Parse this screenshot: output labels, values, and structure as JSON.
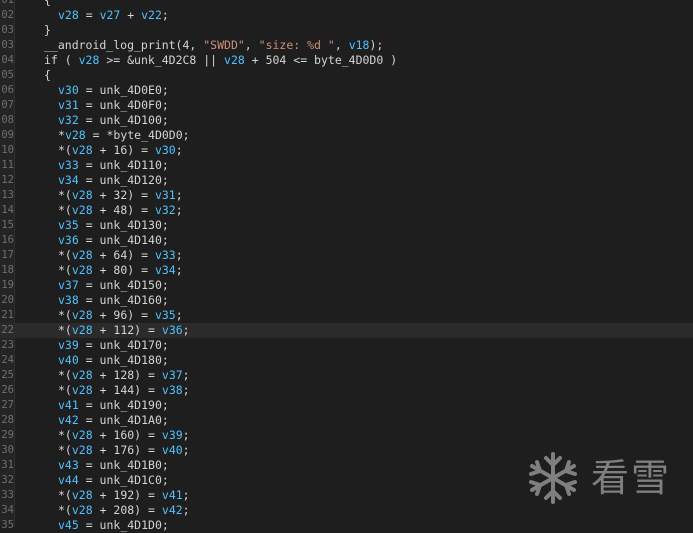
{
  "editor": {
    "lines": [
      {
        "ln": "01",
        "tokens": [
          {
            "t": "{",
            "c": "plain"
          }
        ],
        "indent": 1
      },
      {
        "ln": "02",
        "tokens": [
          {
            "t": "v28",
            "c": "var"
          },
          {
            "t": " = ",
            "c": "plain"
          },
          {
            "t": "v27",
            "c": "var"
          },
          {
            "t": " + ",
            "c": "plain"
          },
          {
            "t": "v22",
            "c": "var"
          },
          {
            "t": ";",
            "c": "plain"
          }
        ],
        "indent": 2
      },
      {
        "ln": "03",
        "tokens": [
          {
            "t": "}",
            "c": "plain"
          }
        ],
        "indent": 1
      },
      {
        "ln": "03",
        "tokens": [
          {
            "t": "__android_log_print(4, ",
            "c": "plain"
          },
          {
            "t": "\"SWDD\"",
            "c": "str"
          },
          {
            "t": ", ",
            "c": "plain"
          },
          {
            "t": "\"size: %d \"",
            "c": "str"
          },
          {
            "t": ", ",
            "c": "plain"
          },
          {
            "t": "v18",
            "c": "var"
          },
          {
            "t": ");",
            "c": "plain"
          }
        ],
        "indent": 1
      },
      {
        "ln": "04",
        "tokens": [
          {
            "t": "if ( ",
            "c": "plain"
          },
          {
            "t": "v28",
            "c": "var"
          },
          {
            "t": " >= &unk_4D2C8 || ",
            "c": "plain"
          },
          {
            "t": "v28",
            "c": "var"
          },
          {
            "t": " + 504 <= byte_4D0D0 )",
            "c": "plain"
          }
        ],
        "indent": 1
      },
      {
        "ln": "05",
        "tokens": [
          {
            "t": "{",
            "c": "plain"
          }
        ],
        "indent": 1
      },
      {
        "ln": "06",
        "tokens": [
          {
            "t": "v30",
            "c": "var"
          },
          {
            "t": " = unk_4D0E0;",
            "c": "plain"
          }
        ],
        "indent": 2
      },
      {
        "ln": "07",
        "tokens": [
          {
            "t": "v31",
            "c": "var"
          },
          {
            "t": " = unk_4D0F0;",
            "c": "plain"
          }
        ],
        "indent": 2
      },
      {
        "ln": "08",
        "tokens": [
          {
            "t": "v32",
            "c": "var"
          },
          {
            "t": " = unk_4D100;",
            "c": "plain"
          }
        ],
        "indent": 2
      },
      {
        "ln": "09",
        "tokens": [
          {
            "t": "*",
            "c": "plain"
          },
          {
            "t": "v28",
            "c": "var"
          },
          {
            "t": " = *byte_4D0D0;",
            "c": "plain"
          }
        ],
        "indent": 2
      },
      {
        "ln": "10",
        "tokens": [
          {
            "t": "*(",
            "c": "plain"
          },
          {
            "t": "v28",
            "c": "var"
          },
          {
            "t": " + 16) = ",
            "c": "plain"
          },
          {
            "t": "v30",
            "c": "var"
          },
          {
            "t": ";",
            "c": "plain"
          }
        ],
        "indent": 2
      },
      {
        "ln": "11",
        "tokens": [
          {
            "t": "v33",
            "c": "var"
          },
          {
            "t": " = unk_4D110;",
            "c": "plain"
          }
        ],
        "indent": 2
      },
      {
        "ln": "12",
        "tokens": [
          {
            "t": "v34",
            "c": "var"
          },
          {
            "t": " = unk_4D120;",
            "c": "plain"
          }
        ],
        "indent": 2
      },
      {
        "ln": "13",
        "tokens": [
          {
            "t": "*(",
            "c": "plain"
          },
          {
            "t": "v28",
            "c": "var"
          },
          {
            "t": " + 32) = ",
            "c": "plain"
          },
          {
            "t": "v31",
            "c": "var"
          },
          {
            "t": ";",
            "c": "plain"
          }
        ],
        "indent": 2
      },
      {
        "ln": "14",
        "tokens": [
          {
            "t": "*(",
            "c": "plain"
          },
          {
            "t": "v28",
            "c": "var"
          },
          {
            "t": " + 48) = ",
            "c": "plain"
          },
          {
            "t": "v32",
            "c": "var"
          },
          {
            "t": ";",
            "c": "plain"
          }
        ],
        "indent": 2
      },
      {
        "ln": "15",
        "tokens": [
          {
            "t": "v35",
            "c": "var"
          },
          {
            "t": " = unk_4D130;",
            "c": "plain"
          }
        ],
        "indent": 2
      },
      {
        "ln": "16",
        "tokens": [
          {
            "t": "v36",
            "c": "var"
          },
          {
            "t": " = unk_4D140;",
            "c": "plain"
          }
        ],
        "indent": 2
      },
      {
        "ln": "17",
        "tokens": [
          {
            "t": "*(",
            "c": "plain"
          },
          {
            "t": "v28",
            "c": "var"
          },
          {
            "t": " + 64) = ",
            "c": "plain"
          },
          {
            "t": "v33",
            "c": "var"
          },
          {
            "t": ";",
            "c": "plain"
          }
        ],
        "indent": 2
      },
      {
        "ln": "18",
        "tokens": [
          {
            "t": "*(",
            "c": "plain"
          },
          {
            "t": "v28",
            "c": "var"
          },
          {
            "t": " + 80) = ",
            "c": "plain"
          },
          {
            "t": "v34",
            "c": "var"
          },
          {
            "t": ";",
            "c": "plain"
          }
        ],
        "indent": 2
      },
      {
        "ln": "19",
        "tokens": [
          {
            "t": "v37",
            "c": "var"
          },
          {
            "t": " = unk_4D150;",
            "c": "plain"
          }
        ],
        "indent": 2
      },
      {
        "ln": "20",
        "tokens": [
          {
            "t": "v38",
            "c": "var"
          },
          {
            "t": " = unk_4D160;",
            "c": "plain"
          }
        ],
        "indent": 2
      },
      {
        "ln": "21",
        "tokens": [
          {
            "t": "*(",
            "c": "plain"
          },
          {
            "t": "v28",
            "c": "var"
          },
          {
            "t": " + 96) = ",
            "c": "plain"
          },
          {
            "t": "v35",
            "c": "var"
          },
          {
            "t": ";",
            "c": "plain"
          }
        ],
        "indent": 2
      },
      {
        "ln": "22",
        "tokens": [
          {
            "t": "*(",
            "c": "plain"
          },
          {
            "t": "v28",
            "c": "var"
          },
          {
            "t": " + 112) = ",
            "c": "plain"
          },
          {
            "t": "v36",
            "c": "var"
          },
          {
            "t": ";",
            "c": "plain"
          }
        ],
        "indent": 2,
        "highlight": true
      },
      {
        "ln": "23",
        "tokens": [
          {
            "t": "v39",
            "c": "var"
          },
          {
            "t": " = unk_4D170;",
            "c": "plain"
          }
        ],
        "indent": 2
      },
      {
        "ln": "24",
        "tokens": [
          {
            "t": "v40",
            "c": "var"
          },
          {
            "t": " = unk_4D180;",
            "c": "plain"
          }
        ],
        "indent": 2
      },
      {
        "ln": "25",
        "tokens": [
          {
            "t": "*(",
            "c": "plain"
          },
          {
            "t": "v28",
            "c": "var"
          },
          {
            "t": " + 128) = ",
            "c": "plain"
          },
          {
            "t": "v37",
            "c": "var"
          },
          {
            "t": ";",
            "c": "plain"
          }
        ],
        "indent": 2
      },
      {
        "ln": "26",
        "tokens": [
          {
            "t": "*(",
            "c": "plain"
          },
          {
            "t": "v28",
            "c": "var"
          },
          {
            "t": " + 144) = ",
            "c": "plain"
          },
          {
            "t": "v38",
            "c": "var"
          },
          {
            "t": ";",
            "c": "plain"
          }
        ],
        "indent": 2
      },
      {
        "ln": "27",
        "tokens": [
          {
            "t": "v41",
            "c": "var"
          },
          {
            "t": " = unk_4D190;",
            "c": "plain"
          }
        ],
        "indent": 2
      },
      {
        "ln": "28",
        "tokens": [
          {
            "t": "v42",
            "c": "var"
          },
          {
            "t": " = unk_4D1A0;",
            "c": "plain"
          }
        ],
        "indent": 2
      },
      {
        "ln": "29",
        "tokens": [
          {
            "t": "*(",
            "c": "plain"
          },
          {
            "t": "v28",
            "c": "var"
          },
          {
            "t": " + 160) = ",
            "c": "plain"
          },
          {
            "t": "v39",
            "c": "var"
          },
          {
            "t": ";",
            "c": "plain"
          }
        ],
        "indent": 2
      },
      {
        "ln": "30",
        "tokens": [
          {
            "t": "*(",
            "c": "plain"
          },
          {
            "t": "v28",
            "c": "var"
          },
          {
            "t": " + 176) = ",
            "c": "plain"
          },
          {
            "t": "v40",
            "c": "var"
          },
          {
            "t": ";",
            "c": "plain"
          }
        ],
        "indent": 2
      },
      {
        "ln": "31",
        "tokens": [
          {
            "t": "v43",
            "c": "var"
          },
          {
            "t": " = unk_4D1B0;",
            "c": "plain"
          }
        ],
        "indent": 2
      },
      {
        "ln": "32",
        "tokens": [
          {
            "t": "v44",
            "c": "var"
          },
          {
            "t": " = unk_4D1C0;",
            "c": "plain"
          }
        ],
        "indent": 2
      },
      {
        "ln": "33",
        "tokens": [
          {
            "t": "*(",
            "c": "plain"
          },
          {
            "t": "v28",
            "c": "var"
          },
          {
            "t": " + 192) = ",
            "c": "plain"
          },
          {
            "t": "v41",
            "c": "var"
          },
          {
            "t": ";",
            "c": "plain"
          }
        ],
        "indent": 2
      },
      {
        "ln": "34",
        "tokens": [
          {
            "t": "*(",
            "c": "plain"
          },
          {
            "t": "v28",
            "c": "var"
          },
          {
            "t": " + 208) = ",
            "c": "plain"
          },
          {
            "t": "v42",
            "c": "var"
          },
          {
            "t": ";",
            "c": "plain"
          }
        ],
        "indent": 2
      },
      {
        "ln": "35",
        "tokens": [
          {
            "t": "v45",
            "c": "var"
          },
          {
            "t": " = unk_4D1D0;",
            "c": "plain"
          }
        ],
        "indent": 2
      }
    ]
  },
  "watermark": {
    "text": "看雪",
    "icon": "snowflake-icon"
  },
  "colors": {
    "background": "#1e1e1e",
    "text": "#d4d4d4",
    "variable": "#4fc1ff",
    "string": "#ce9178",
    "line_number": "#6f6f6f"
  }
}
